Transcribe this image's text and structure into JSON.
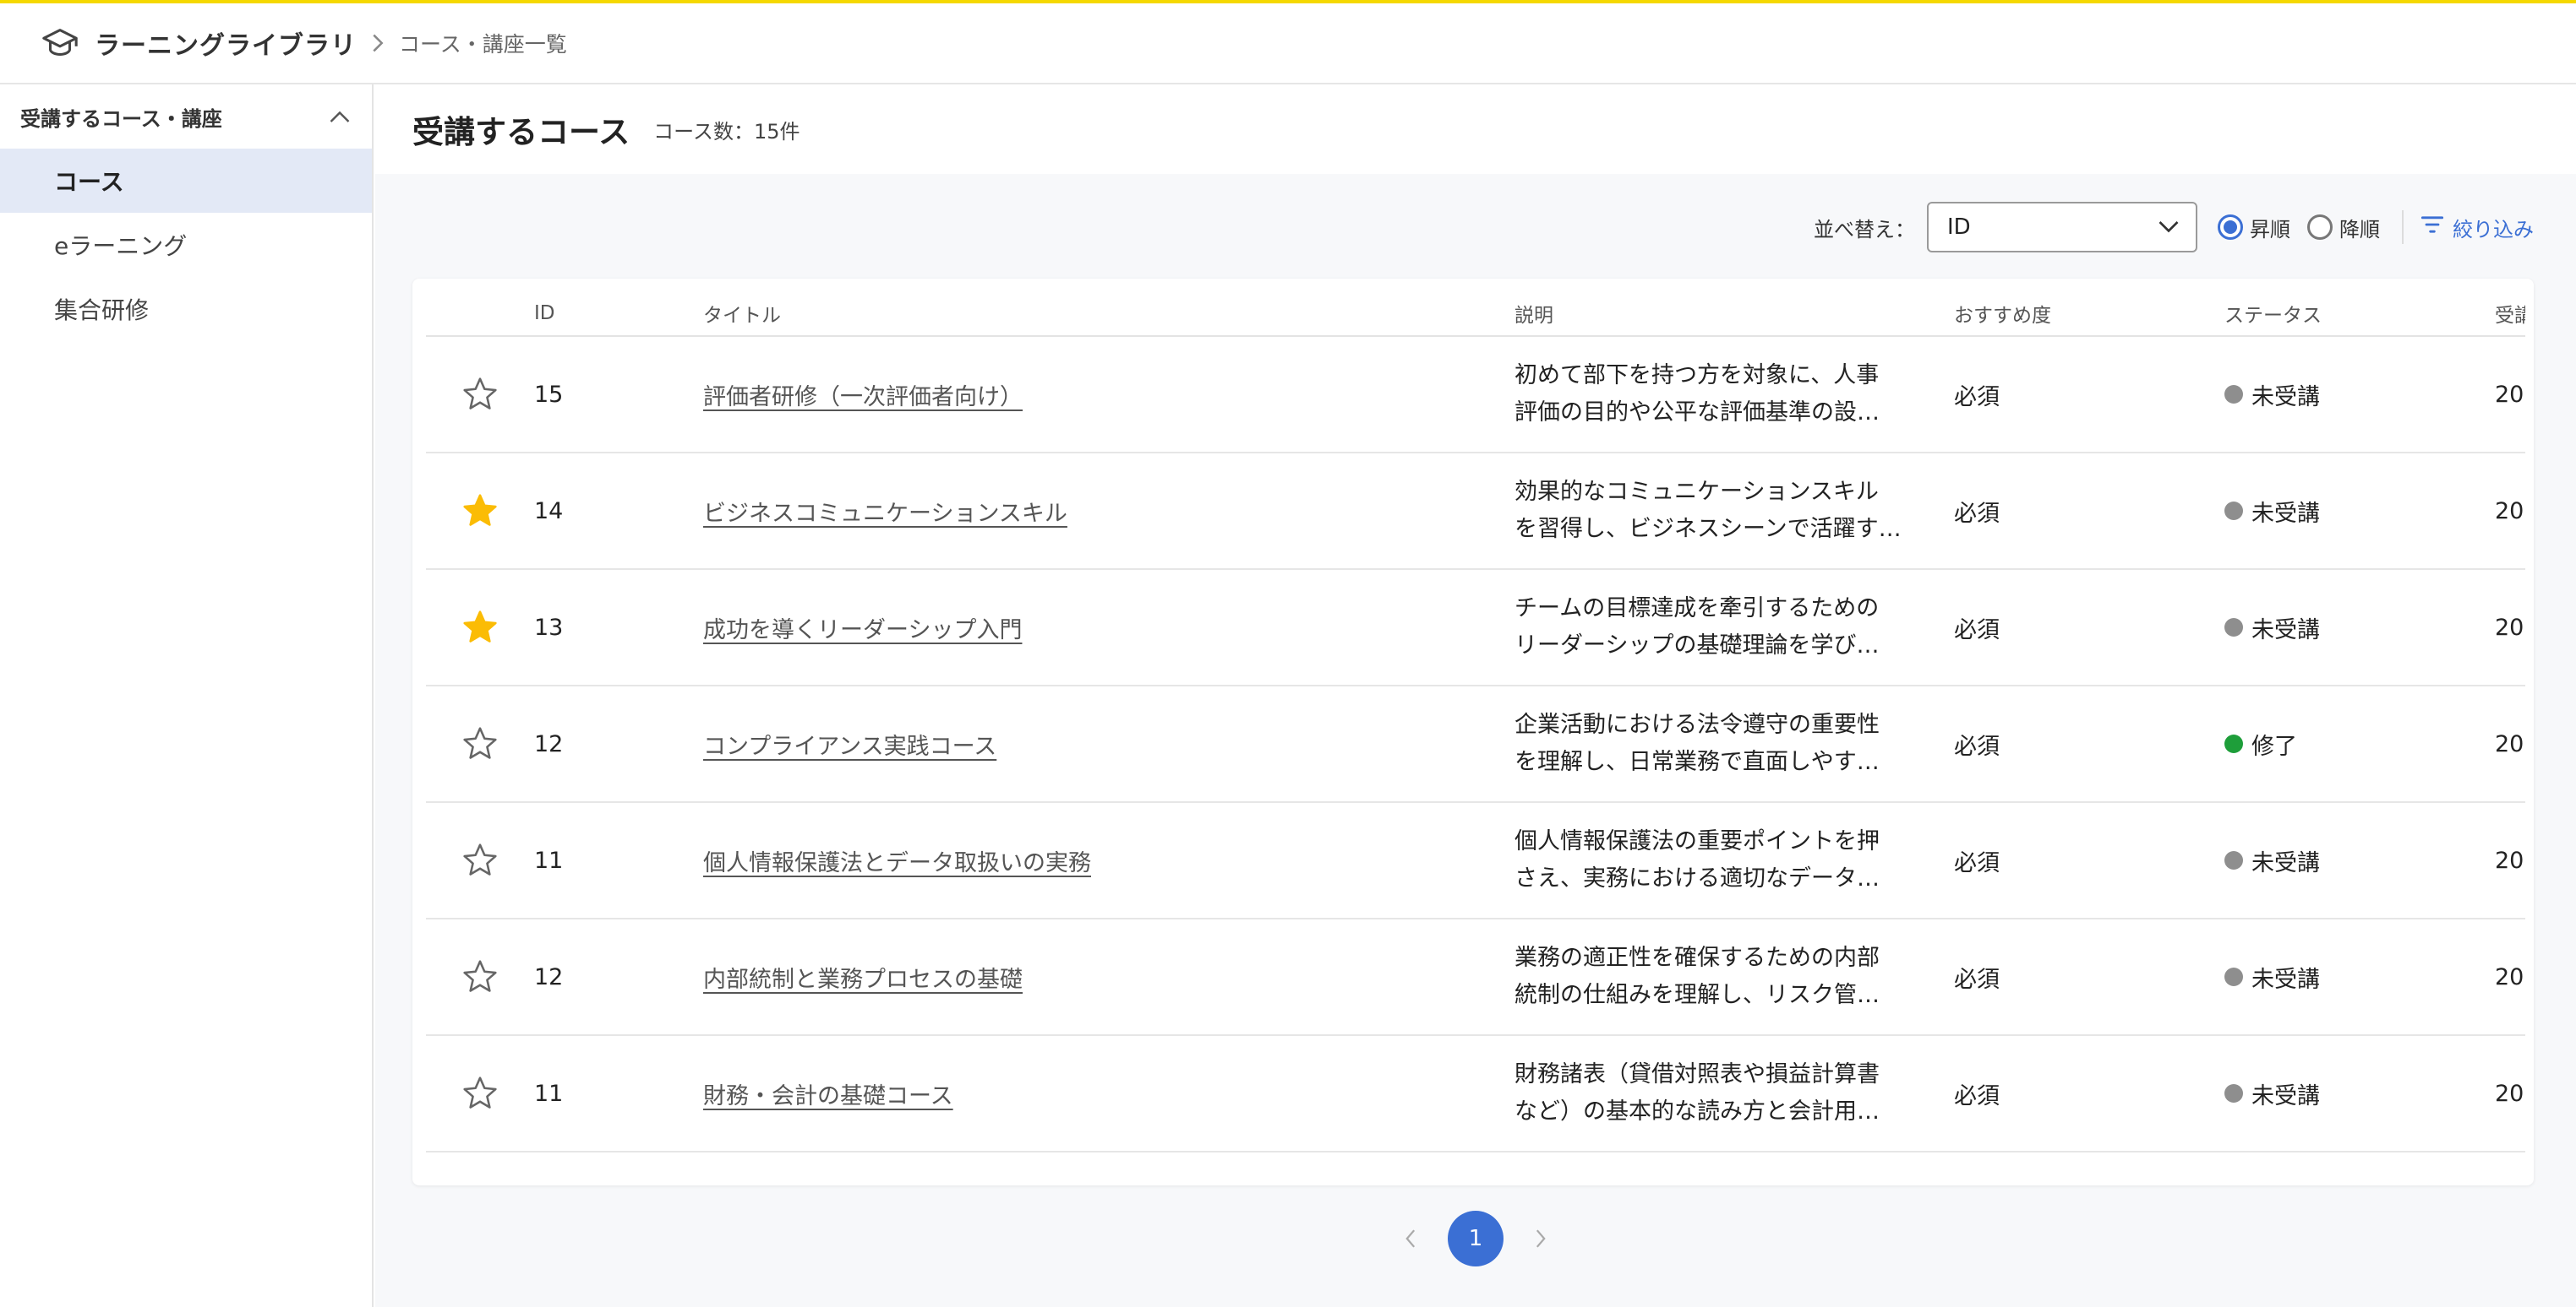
{
  "header": {
    "app_title": "ラーニングライブラリ",
    "breadcrumb": "コース・講座一覧"
  },
  "sidebar": {
    "group_label": "受講するコース・講座",
    "items": [
      {
        "label": "コース",
        "active": true
      },
      {
        "label": "eラーニング",
        "active": false
      },
      {
        "label": "集合研修",
        "active": false
      }
    ]
  },
  "page": {
    "title": "受講するコース",
    "count": "コース数：15件"
  },
  "toolbar": {
    "sort_label": "並べ替え：",
    "sort_value": "ID",
    "asc_label": "昇順",
    "desc_label": "降順",
    "sort_order": "asc",
    "filter_label": "絞り込み"
  },
  "table": {
    "columns": [
      "",
      "ID",
      "タイトル",
      "説明",
      "おすすめ度",
      "ステータス",
      "受講"
    ],
    "rows": [
      {
        "starred": false,
        "id": "15",
        "title": "評価者研修（一次評価者向け）",
        "desc1": "初めて部下を持つ方を対象に、人事",
        "desc2": "評価の目的や公平な評価基準の設…",
        "rec": "必須",
        "status": "未受講",
        "status_color": "#8e8e8e",
        "extra": "20"
      },
      {
        "starred": true,
        "id": "14",
        "title": "ビジネスコミュニケーションスキル",
        "desc1": "効果的なコミュニケーションスキル",
        "desc2": "を習得し、ビジネスシーンで活躍す…",
        "rec": "必須",
        "status": "未受講",
        "status_color": "#8e8e8e",
        "extra": "20"
      },
      {
        "starred": true,
        "id": "13",
        "title": "成功を導くリーダーシップ入門",
        "desc1": "チームの目標達成を牽引するための",
        "desc2": "リーダーシップの基礎理論を学び…",
        "rec": "必須",
        "status": "未受講",
        "status_color": "#8e8e8e",
        "extra": "20"
      },
      {
        "starred": false,
        "id": "12",
        "title": "コンプライアンス実践コース",
        "desc1": "企業活動における法令遵守の重要性",
        "desc2": "を理解し、日常業務で直面しやす…",
        "rec": "必須",
        "status": "修了",
        "status_color": "#1e9e3a",
        "extra": "20"
      },
      {
        "starred": false,
        "id": "11",
        "title": "個人情報保護法とデータ取扱いの実務",
        "desc1": "個人情報保護法の重要ポイントを押",
        "desc2": "さえ、実務における適切なデータ…",
        "rec": "必須",
        "status": "未受講",
        "status_color": "#8e8e8e",
        "extra": "20"
      },
      {
        "starred": false,
        "id": "12",
        "title": "内部統制と業務プロセスの基礎",
        "desc1": "業務の適正性を確保するための内部",
        "desc2": "統制の仕組みを理解し、リスク管…",
        "rec": "必須",
        "status": "未受講",
        "status_color": "#8e8e8e",
        "extra": "20"
      },
      {
        "starred": false,
        "id": "11",
        "title": "財務・会計の基礎コース",
        "desc1": "財務諸表（貸借対照表や損益計算書",
        "desc2": "など）の基本的な読み方と会計用…",
        "rec": "必須",
        "status": "未受講",
        "status_color": "#8e8e8e",
        "extra": "20"
      }
    ]
  },
  "pagination": {
    "current": "1"
  },
  "colors": {
    "accent": "#3b6fd4",
    "top_line": "#f5d800",
    "star_filled": "#fbbc05",
    "active_nav_bg": "#e3e9f6"
  }
}
